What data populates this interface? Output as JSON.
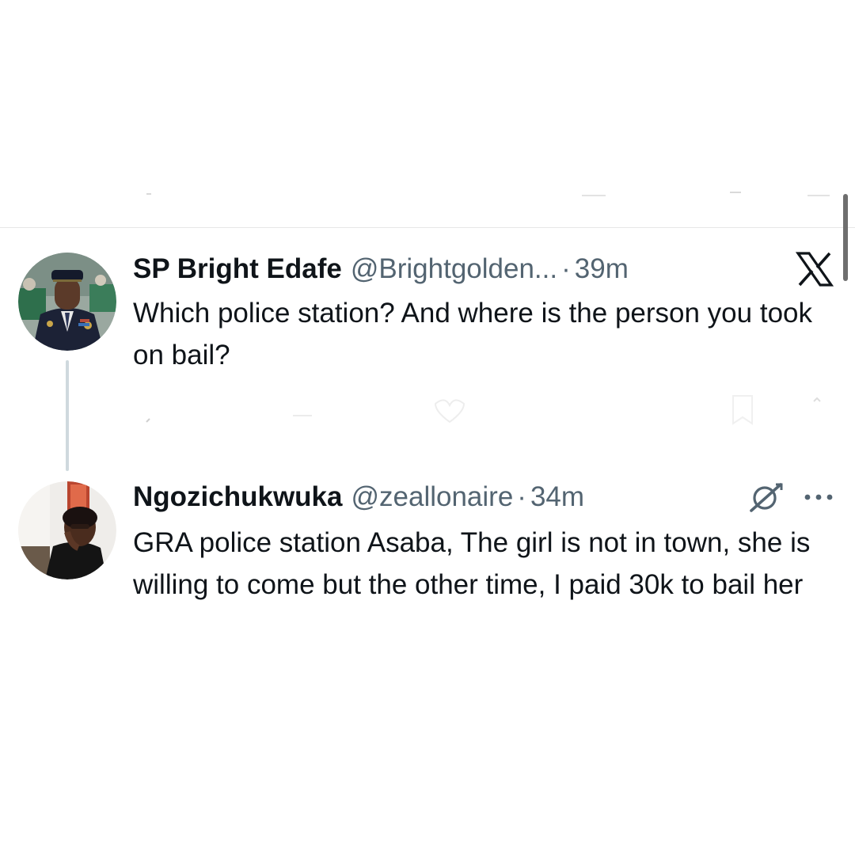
{
  "thread": [
    {
      "author": "SP Bright Edafe",
      "handle": "@Brightgolden...",
      "time": "39m",
      "text": "Which police station? And where is the person you took on bail?"
    },
    {
      "author": "Ngozichukwuka",
      "handle": "@zeallonaire",
      "time": "34m",
      "text": "GRA police station Asaba, The girl is not in town, she is willing to come but the other time, I paid 30k to bail her"
    }
  ],
  "separator": "·",
  "icons": {
    "brand": "x-logo-icon",
    "grok": "grok-icon",
    "more": "more-horizontal-icon",
    "faded_actions": [
      "reply-icon",
      "retweet-icon",
      "like-icon",
      "bookmark-icon",
      "share-icon"
    ]
  },
  "colors": {
    "text_primary": "#0f1419",
    "text_secondary": "#536471",
    "thread_line": "#cfd9de",
    "divider": "#e6e6e6"
  }
}
